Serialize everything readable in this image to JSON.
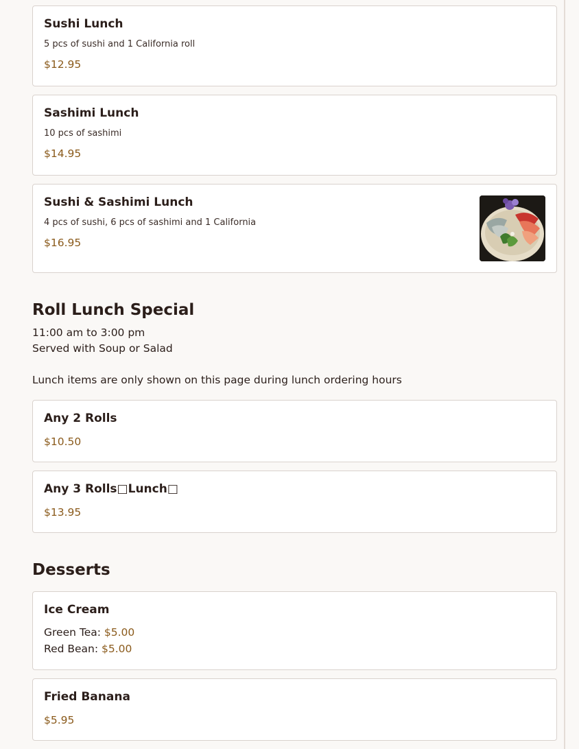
{
  "lunch_items": [
    {
      "name": "Sushi Lunch",
      "desc": "5 pcs of sushi and 1 California roll",
      "price": "$12.95"
    },
    {
      "name": "Sashimi Lunch",
      "desc": "10 pcs of sashimi",
      "price": "$14.95"
    },
    {
      "name": "Sushi & Sashimi Lunch",
      "desc": "4 pcs of sushi, 6 pcs of sashimi and 1 California",
      "price": "$16.95",
      "image_icon": "sushi-sashimi-plate-photo"
    }
  ],
  "roll_section": {
    "title": "Roll Lunch Special",
    "hours": "11:00 am to 3:00 pm",
    "served": "Served with Soup or Salad",
    "notice": "Lunch items are only shown on this page during lunch ordering hours",
    "items": [
      {
        "name": "Any 2 Rolls",
        "price": "$10.50"
      },
      {
        "name": "Any 3 Rolls□Lunch□",
        "price": "$13.95"
      }
    ]
  },
  "desserts": {
    "title": "Desserts",
    "ice_cream": {
      "name": "Ice Cream",
      "options": [
        {
          "label": "Green Tea:",
          "price": "$5.00"
        },
        {
          "label": "Red Bean:",
          "price": "$5.00"
        }
      ]
    },
    "fried_banana": {
      "name": "Fried Banana",
      "price": "$5.95"
    }
  },
  "colors": {
    "price": "#8a5a1b",
    "text": "#2b1e1a",
    "border": "#d9d2cd",
    "background": "#faf8f6"
  }
}
